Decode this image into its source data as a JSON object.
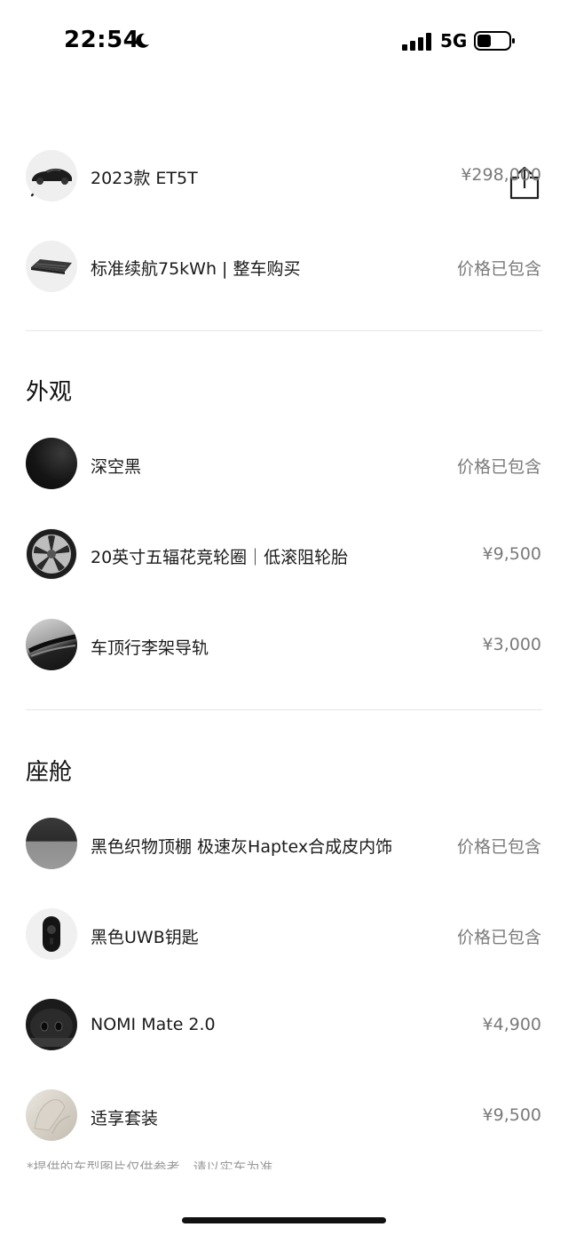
{
  "status": {
    "time": "22:54",
    "network": "5G",
    "moon_icon": "moon-icon",
    "signal_icon": "cellular-signal-icon",
    "battery_icon": "battery-icon"
  },
  "toolbar": {
    "close_icon": "close-icon",
    "share_icon": "share-icon"
  },
  "model": {
    "items": [
      {
        "label": "2023款 ET5T",
        "price": "¥298,000",
        "thumb": "car-thumbnail"
      },
      {
        "label": "标准续航75kWh | 整车购买",
        "price": "价格已包含",
        "thumb": "battery-pack-thumbnail"
      }
    ]
  },
  "exterior": {
    "title": "外观",
    "items": [
      {
        "label": "深空黑",
        "price": "价格已包含",
        "thumb": "paint-swatch-black"
      },
      {
        "label": "20英寸五辐花竞轮圈｜低滚阻轮胎",
        "price": "¥9,500",
        "thumb": "wheel-thumbnail"
      },
      {
        "label": "车顶行李架导轨",
        "price": "¥3,000",
        "thumb": "roof-rail-thumbnail"
      }
    ]
  },
  "cabin": {
    "title": "座舱",
    "items": [
      {
        "label": "黑色织物顶棚 极速灰Haptex合成皮内饰",
        "price": "价格已包含",
        "thumb": "interior-swatch"
      },
      {
        "label": "黑色UWB钥匙",
        "price": "价格已包含",
        "thumb": "key-fob-thumbnail"
      },
      {
        "label": "NOMI Mate 2.0",
        "price": "¥4,900",
        "thumb": "nomi-thumbnail"
      },
      {
        "label": "适享套装",
        "price": "¥9,500",
        "thumb": "comfort-package-thumbnail"
      }
    ]
  },
  "footnote": "*提供的车型图片仅供参考，请以实车为准",
  "colors": {
    "text": "#1a1a1a",
    "price_text": "#7a7a7a",
    "divider": "#e6e6e6",
    "background": "#ffffff"
  }
}
